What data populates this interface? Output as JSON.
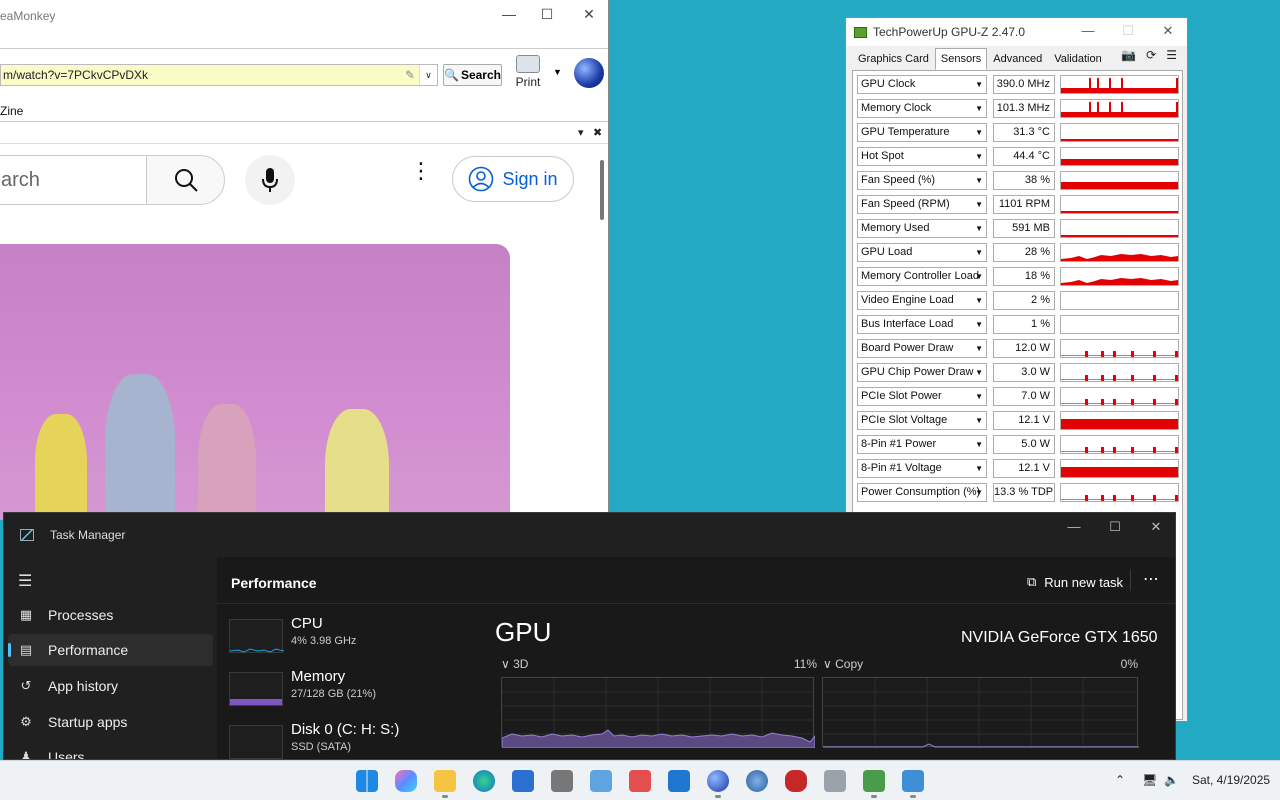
{
  "browser": {
    "title": "eaMonkey",
    "url": "m/watch?v=7PCkvCPvDXk",
    "search_button": "Search",
    "print_button": "Print",
    "bookmark": "Zine",
    "yt_search_placeholder": "arch",
    "yt_signin": "Sign in"
  },
  "gpuz": {
    "title": "TechPowerUp GPU-Z 2.47.0",
    "tabs": [
      "Graphics Card",
      "Sensors",
      "Advanced",
      "Validation"
    ],
    "active_tab": "Sensors",
    "accent_color": "#e30000",
    "sensors": [
      {
        "name": "GPU Clock",
        "value": "390.0 MHz"
      },
      {
        "name": "Memory Clock",
        "value": "101.3 MHz"
      },
      {
        "name": "GPU Temperature",
        "value": "31.3 °C"
      },
      {
        "name": "Hot Spot",
        "value": "44.4 °C"
      },
      {
        "name": "Fan Speed (%)",
        "value": "38 %"
      },
      {
        "name": "Fan Speed (RPM)",
        "value": "1101 RPM"
      },
      {
        "name": "Memory Used",
        "value": "591 MB"
      },
      {
        "name": "GPU Load",
        "value": "28 %"
      },
      {
        "name": "Memory Controller Load",
        "value": "18 %"
      },
      {
        "name": "Video Engine Load",
        "value": "2 %"
      },
      {
        "name": "Bus Interface Load",
        "value": "1 %"
      },
      {
        "name": "Board Power Draw",
        "value": "12.0 W"
      },
      {
        "name": "GPU Chip Power Draw",
        "value": "3.0 W"
      },
      {
        "name": "PCIe Slot Power",
        "value": "7.0 W"
      },
      {
        "name": "PCIe Slot Voltage",
        "value": "12.1 V"
      },
      {
        "name": "8-Pin #1 Power",
        "value": "5.0 W"
      },
      {
        "name": "8-Pin #1 Voltage",
        "value": "12.1 V"
      },
      {
        "name": "Power Consumption (%)",
        "value": "13.3 % TDP"
      }
    ]
  },
  "taskmgr": {
    "title": "Task Manager",
    "nav": [
      "Processes",
      "Performance",
      "App history",
      "Startup apps",
      "Users"
    ],
    "active_nav": "Performance",
    "section_title": "Performance",
    "run_new_task": "Run new task",
    "perf_items": [
      {
        "name": "CPU",
        "sub": "4% 3.98 GHz",
        "color": "#1ba1e2"
      },
      {
        "name": "Memory",
        "sub": "27/128 GB (21%)",
        "color": "#7e57c2"
      },
      {
        "name": "Disk 0 (C: H: S:)",
        "sub": "SSD (SATA)",
        "color": "#4caf50"
      }
    ],
    "gpu_title": "GPU",
    "gpu_name": "NVIDIA GeForce GTX 1650",
    "graphs": [
      {
        "label": "3D",
        "percent": "11%"
      },
      {
        "label": "Copy",
        "percent": "0%"
      }
    ],
    "graph_color": "#9b7fd4"
  },
  "taskbar": {
    "time_date": "Sat, 4/19/2025"
  }
}
